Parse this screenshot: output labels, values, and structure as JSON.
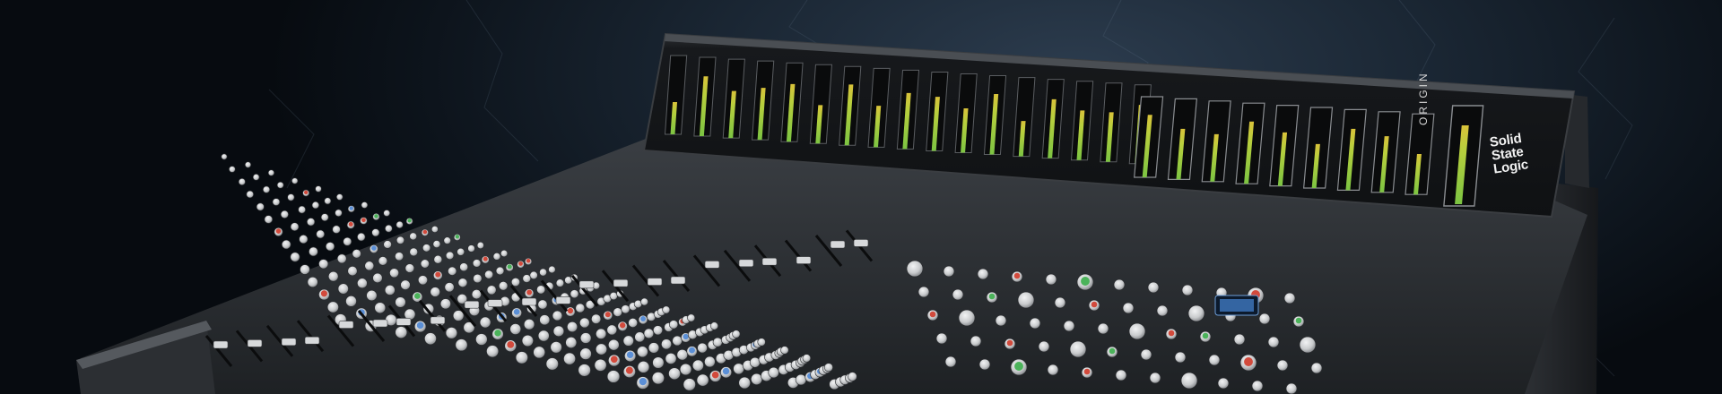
{
  "scene": {
    "subject": "large-format analog mixing console",
    "meter_bridge": {
      "brand_lines": [
        "Solid",
        "State",
        "Logic"
      ],
      "model_label": "ORIGIN"
    },
    "colors": {
      "background": "#1a2633",
      "console_body": "#2a2d31",
      "meter_bridge": "#141618",
      "meter_green": "#7cc442",
      "meter_yellow": "#d9c23a",
      "knob_grey": "#c9cbcd",
      "knob_blue": "#5b8fd6",
      "knob_red": "#d24a3c",
      "knob_green": "#4bb35a"
    }
  }
}
